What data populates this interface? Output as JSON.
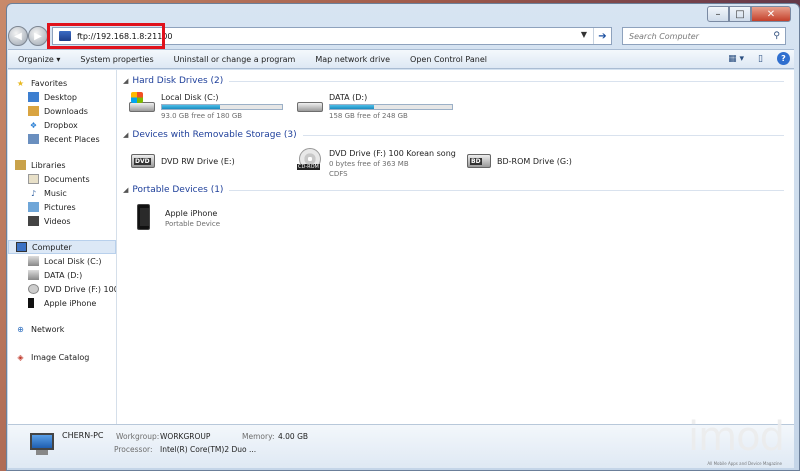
{
  "titlebar": {
    "minimize": "–",
    "maximize": "□",
    "close": "✕"
  },
  "address": {
    "back": "◀",
    "forward": "▶",
    "value": "ftp://192.168.1.8:21100",
    "dropdown": "▼",
    "go": "➔"
  },
  "search": {
    "placeholder": "Search Computer",
    "icon": "search-icon"
  },
  "toolbar": {
    "organize": "Organize ▾",
    "system_properties": "System properties",
    "uninstall": "Uninstall or change a program",
    "map_drive": "Map network drive",
    "control_panel": "Open Control Panel",
    "views_icon": "▦ ▾",
    "preview_icon": "▯",
    "help": "?"
  },
  "nav": {
    "favorites": {
      "label": "Favorites",
      "items": [
        "Desktop",
        "Downloads",
        "Dropbox",
        "Recent Places"
      ]
    },
    "libraries": {
      "label": "Libraries",
      "items": [
        "Documents",
        "Music",
        "Pictures",
        "Videos"
      ]
    },
    "computer": {
      "label": "Computer",
      "items": [
        "Local Disk (C:)",
        "DATA (D:)",
        "DVD Drive (F:) 100 K",
        "Apple iPhone"
      ]
    },
    "network": "Network",
    "image_catalog": "Image Catalog"
  },
  "sections": {
    "hdd": "Hard Disk Drives (2)",
    "removable": "Devices with Removable Storage (3)",
    "portable": "Portable Devices (1)"
  },
  "drives": [
    {
      "name": "Local Disk (C:)",
      "free": "93.0 GB free of 180 GB",
      "used_fraction": 0.48
    },
    {
      "name": "DATA (D:)",
      "free": "158 GB free of 248 GB",
      "used_fraction": 0.36
    }
  ],
  "removable": [
    {
      "name": "DVD RW Drive (E:)",
      "label": "DVD"
    },
    {
      "name": "DVD Drive (F:) 100 Korean  song",
      "sub1": "0 bytes free of 363 MB",
      "sub2": "CDFS",
      "label": "CD-ROM"
    },
    {
      "name": "BD-ROM Drive (G:)",
      "label": "BD"
    }
  ],
  "portable": [
    {
      "name": "Apple iPhone",
      "sub": "Portable Device"
    }
  ],
  "status": {
    "pc_name": "CHERN-PC",
    "workgroup_label": "Workgroup:",
    "workgroup": "WORKGROUP",
    "memory_label": "Memory:",
    "memory": "4.00 GB",
    "processor_label": "Processor:",
    "processor": "Intel(R) Core(TM)2 Duo ..."
  },
  "watermark": {
    "text": "imod",
    "sub": "All Mobile Apps and Device Magazine"
  }
}
